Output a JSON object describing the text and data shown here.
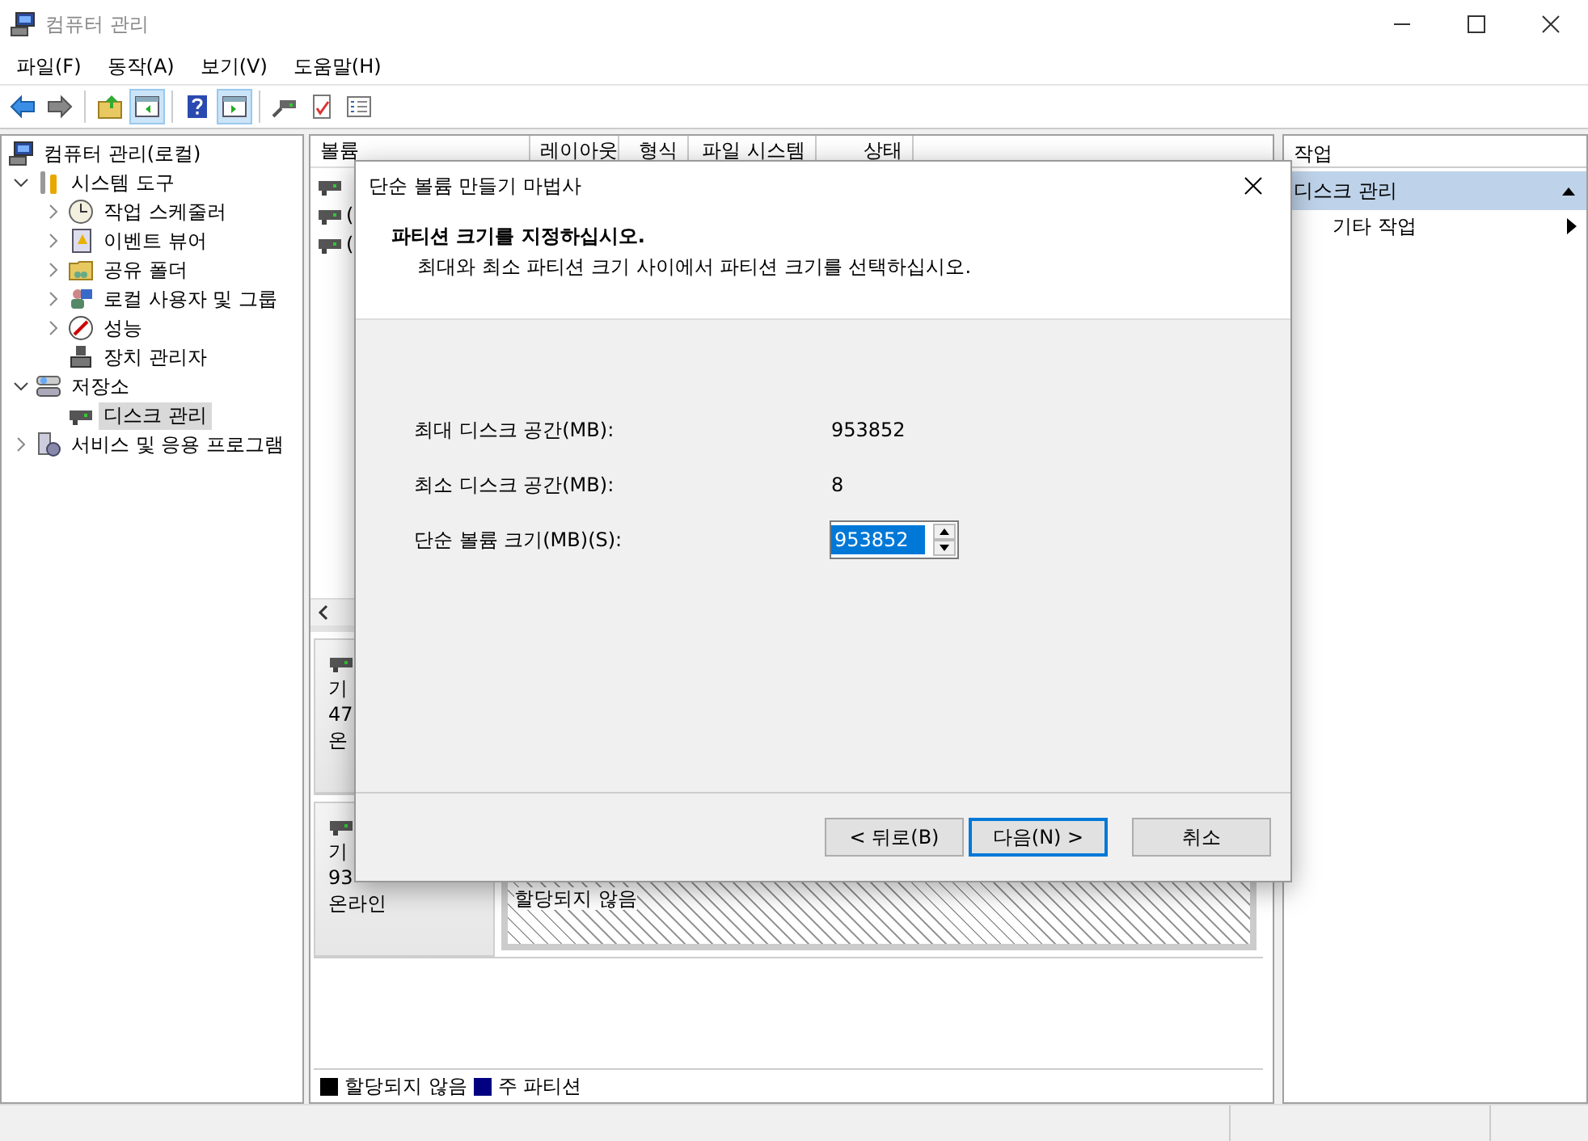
{
  "window": {
    "title": "컴퓨터 관리"
  },
  "menu": [
    {
      "label": "파일(F)"
    },
    {
      "label": "동작(A)"
    },
    {
      "label": "보기(V)"
    },
    {
      "label": "도움말(H)"
    }
  ],
  "toolbar_groups": [
    {
      "buttons": [
        {
          "kind": "back",
          "pressed": false
        },
        {
          "kind": "forward",
          "pressed": false
        }
      ]
    },
    {
      "buttons": [
        {
          "kind": "up",
          "pressed": false
        },
        {
          "kind": "tree",
          "pressed": true
        }
      ]
    },
    {
      "buttons": [
        {
          "kind": "help",
          "pressed": false
        },
        {
          "kind": "actionpane",
          "pressed": true
        }
      ]
    },
    {
      "buttons": [
        {
          "kind": "connect",
          "pressed": false
        },
        {
          "kind": "check",
          "pressed": false
        },
        {
          "kind": "list",
          "pressed": false
        }
      ]
    }
  ],
  "tree": [
    {
      "label": "컴퓨터 관리(로컬)",
      "kind": "computer",
      "selected": false,
      "children": [
        {
          "label": "시스템 도구",
          "kind": "tools",
          "expanded": true,
          "selected": false,
          "children": [
            {
              "label": "작업 스케줄러",
              "kind": "clock",
              "expanded": false,
              "selected": false
            },
            {
              "label": "이벤트 뷰어",
              "kind": "log",
              "expanded": false,
              "selected": false
            },
            {
              "label": "공유 폴더",
              "kind": "folder",
              "expanded": false,
              "selected": false
            },
            {
              "label": "로컬 사용자 및 그룹",
              "kind": "users",
              "expanded": false,
              "selected": false
            },
            {
              "label": "성능",
              "kind": "gauge",
              "expanded": false,
              "selected": false
            },
            {
              "label": "장치 관리자",
              "kind": "device",
              "selected": false
            }
          ]
        },
        {
          "label": "저장소",
          "kind": "storage",
          "expanded": true,
          "selected": false,
          "children": [
            {
              "label": "디스크 관리",
              "kind": "disk",
              "selected": true
            }
          ]
        },
        {
          "label": "서비스 및 응용 프로그램",
          "kind": "services",
          "expanded": false,
          "selected": false
        }
      ]
    }
  ],
  "volume_table": {
    "columns": [
      "볼륨",
      "레이아웃",
      "형식",
      "파일 시스템",
      "상태"
    ],
    "rows": [
      {
        "kind": "disk"
      },
      {
        "kind": "disk",
        "volume": "("
      },
      {
        "kind": "disk",
        "volume": "("
      }
    ]
  },
  "disks": [
    {
      "lines": [
        "기",
        "47",
        "온"
      ]
    },
    {
      "lines": [
        "기",
        "93",
        "온라인"
      ],
      "partitions": [
        {
          "kind": "unallocated",
          "label": "할당되지 않음"
        }
      ]
    }
  ],
  "legend": [
    {
      "label": "할당되지 않음",
      "color": "#000000"
    },
    {
      "label": "주 파티션",
      "color": "#000080"
    }
  ],
  "actions": {
    "title": "작업",
    "sections": [
      {
        "label": "디스크 관리",
        "expanded": true,
        "items": [
          {
            "label": "기타 작업"
          }
        ]
      }
    ]
  },
  "dialog": {
    "title": "단순 볼륨 만들기 마법사",
    "heading": "파티션 크기를 지정하십시오.",
    "subheading": "최대와 최소 파티션 크기 사이에서 파티션 크기를 선택하십시오.",
    "fields": [
      {
        "kind": "text",
        "label": "최대 디스크 공간(MB):",
        "value": "953852"
      },
      {
        "kind": "text",
        "label": "최소 디스크 공간(MB):",
        "value": "8"
      },
      {
        "kind": "spinner",
        "label": "단순 볼륨 크기(MB)(S):",
        "value": "953852",
        "selected": true
      }
    ],
    "buttons": [
      {
        "label": "< 뒤로(B)",
        "default": false
      },
      {
        "label": "다음(N) >",
        "default": true
      },
      {
        "label": "취소",
        "default": false
      }
    ]
  }
}
